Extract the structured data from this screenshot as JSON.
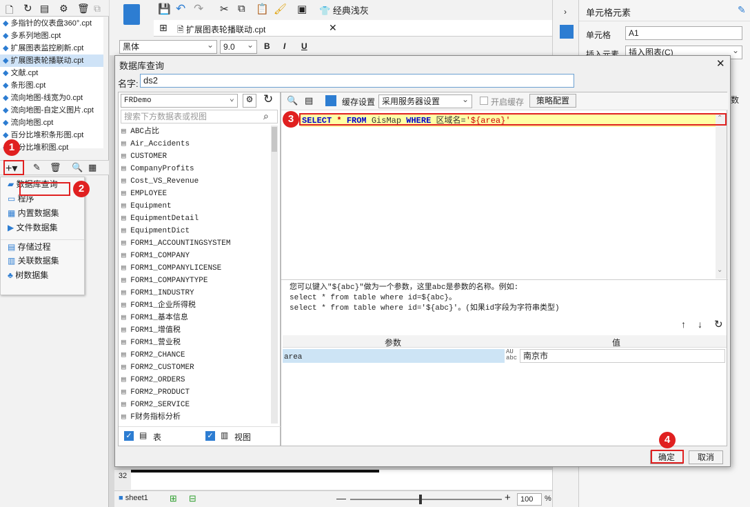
{
  "files": [
    "多指针的仪表盘360°.cpt",
    "多系列地图.cpt",
    "扩展图表监控刷新.cpt",
    "扩展图表轮播联动.cpt",
    "文献.cpt",
    "条形图.cpt",
    "流向地图-线宽为0.cpt",
    "流向地图-自定义图片.cpt",
    "流向地图.cpt",
    "百分比堆积条形图.cpt",
    "百分比堆积图.cpt"
  ],
  "dsmenu": [
    "数据库查询",
    "程序",
    "内置数据集",
    "文件数据集",
    "存储过程",
    "关联数据集",
    "树数据集"
  ],
  "editor": {
    "tab": "扩展图表轮播联动.cpt",
    "font": "黑体",
    "size": "9.0",
    "style_label": "经典浅灰",
    "row": "32",
    "sheet": "sheet1",
    "zoom": "100",
    "zoom_unit": "%"
  },
  "right": {
    "title": "单元格元素",
    "cell_label": "单元格",
    "cell_value": "A1",
    "insert_label": "插入元素",
    "insert_value": "插入图表(C)",
    "trunc": "数"
  },
  "dialog": {
    "title": "数据库查询",
    "name_label": "名字:",
    "name_value": "ds2",
    "connection": "FRDemo",
    "search_placeholder": "搜索下方数据表或视图",
    "tables": [
      "ABC占比",
      "Air_Accidents",
      "CUSTOMER",
      "CompanyProfits",
      "Cost_VS_Revenue",
      "EMPLOYEE",
      "Equipment",
      "EquipmentDetail",
      "EquipmentDict",
      "FORM1_ACCOUNTINGSYSTEM",
      "FORM1_COMPANY",
      "FORM1_COMPANYLICENSE",
      "FORM1_COMPANYTYPE",
      "FORM1_INDUSTRY",
      "FORM1_企业所得税",
      "FORM1_基本信息",
      "FORM1_增值税",
      "FORM1_营业税",
      "FORM2_CHANCE",
      "FORM2_CUSTOMER",
      "FORM2_ORDERS",
      "FORM2_PRODUCT",
      "FORM2_SERVICE",
      "F财务指标分析"
    ],
    "check_table": "表",
    "check_view": "视图",
    "cache_label": "缓存设置",
    "cache_value": "采用服务器设置",
    "enable_cache": "开启缓存",
    "strategy": "策略配置",
    "sql": {
      "select": "SELECT",
      "star": "*",
      "from": "FROM",
      "table": "GisMap",
      "where": "WHERE",
      "col": "区域名",
      "eq": "=",
      "val": "'${area}'"
    },
    "hint1": "您可以键入\"${abc}\"做为一个参数，这里abc是参数的名称。例如:",
    "hint2": "select * from table where id=${abc}。",
    "hint3": "select * from table where id='${abc}'。(如果id字段为字符串类型)",
    "param_header": "参数",
    "value_header": "值",
    "param_name": "area",
    "param_value": "南京市",
    "ok": "确定",
    "cancel": "取消"
  },
  "badges": [
    "1",
    "2",
    "3",
    "4"
  ]
}
